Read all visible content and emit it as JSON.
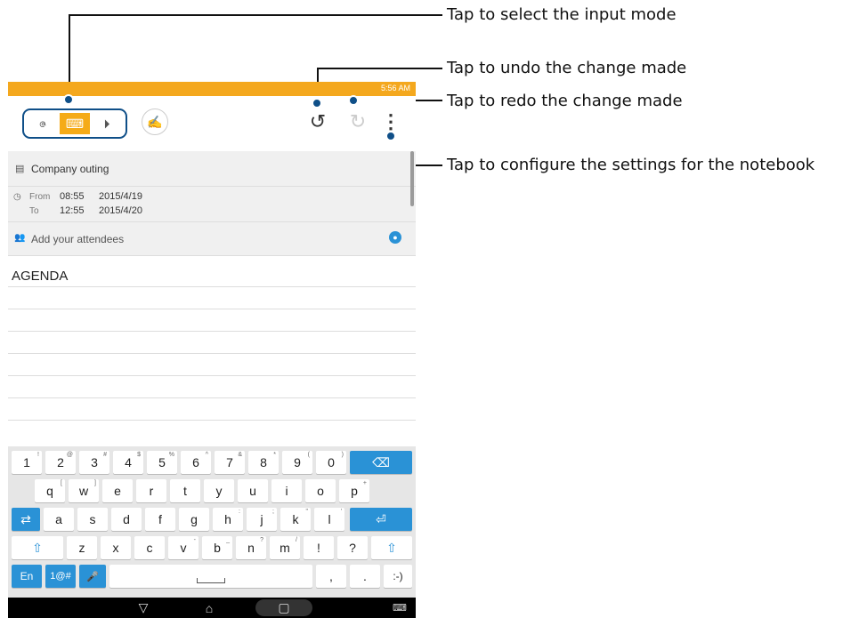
{
  "callouts": [
    {
      "text": "Tap to select the input mode"
    },
    {
      "text": "Tap to undo the change made"
    },
    {
      "text": "Tap to redo the change made"
    },
    {
      "text": "Tap to configure the settings for the notebook"
    }
  ],
  "status_bar": {
    "time": "5:56 AM",
    "color": "#f4a81e"
  },
  "toolbar": {
    "modes": [
      {
        "name": "handwriting-mode",
        "icon": "handwriting-icon",
        "glyph": "ဇ"
      },
      {
        "name": "keyboard-mode",
        "icon": "keyboard-icon",
        "glyph": "⌨"
      },
      {
        "name": "pen-mode",
        "icon": "pen-icon",
        "glyph": "⏵"
      }
    ],
    "undo_glyph": "↺",
    "redo_glyph": "↻",
    "menu_glyph": "⋮",
    "sign_glyph": "✍"
  },
  "note": {
    "title": "Company outing",
    "from_label": "From",
    "from_time": "08:55",
    "from_date": "2015/4/19",
    "to_label": "To",
    "to_time": "12:55",
    "to_date": "2015/4/20",
    "attendees_placeholder": "Add your attendees",
    "body_first_line": "AGENDA"
  },
  "keyboard": {
    "row1": [
      {
        "k": "1",
        "s": "!"
      },
      {
        "k": "2",
        "s": "@"
      },
      {
        "k": "3",
        "s": "#"
      },
      {
        "k": "4",
        "s": "$"
      },
      {
        "k": "5",
        "s": "%"
      },
      {
        "k": "6",
        "s": "^"
      },
      {
        "k": "7",
        "s": "&"
      },
      {
        "k": "8",
        "s": "*"
      },
      {
        "k": "9",
        "s": "("
      },
      {
        "k": "0",
        "s": ")"
      }
    ],
    "row2": [
      {
        "k": "q",
        "s": "["
      },
      {
        "k": "w",
        "s": "]"
      },
      {
        "k": "e",
        "s": ""
      },
      {
        "k": "r",
        "s": ""
      },
      {
        "k": "t",
        "s": ""
      },
      {
        "k": "y",
        "s": ""
      },
      {
        "k": "u",
        "s": ""
      },
      {
        "k": "i",
        "s": ""
      },
      {
        "k": "o",
        "s": ""
      },
      {
        "k": "p",
        "s": "+"
      }
    ],
    "row3": [
      {
        "k": "a",
        "s": ""
      },
      {
        "k": "s",
        "s": ""
      },
      {
        "k": "d",
        "s": ""
      },
      {
        "k": "f",
        "s": ""
      },
      {
        "k": "g",
        "s": ""
      },
      {
        "k": "h",
        "s": ":"
      },
      {
        "k": "j",
        "s": ";"
      },
      {
        "k": "k",
        "s": "\""
      },
      {
        "k": "l",
        "s": "'"
      }
    ],
    "row4": [
      {
        "k": "z",
        "s": ""
      },
      {
        "k": "x",
        "s": ""
      },
      {
        "k": "c",
        "s": ""
      },
      {
        "k": "v",
        "s": "-"
      },
      {
        "k": "b",
        "s": "_"
      },
      {
        "k": "n",
        "s": "?"
      },
      {
        "k": "m",
        "s": "/"
      },
      {
        "k": "!",
        "s": ""
      },
      {
        "k": "?",
        "s": ""
      }
    ],
    "backspace": "⌫",
    "tab": "⇄",
    "enter": "⏎",
    "shift": "⇧",
    "lang": "En",
    "symbols": "1@#",
    "mic": "🎤",
    "comma": ",",
    "period": ".",
    "emoji": ":-)",
    "accent_color": "#2a92d6"
  },
  "navbar": {
    "back": "▽",
    "home": "⌂",
    "recents": "▢",
    "keyboard": "⌨"
  }
}
